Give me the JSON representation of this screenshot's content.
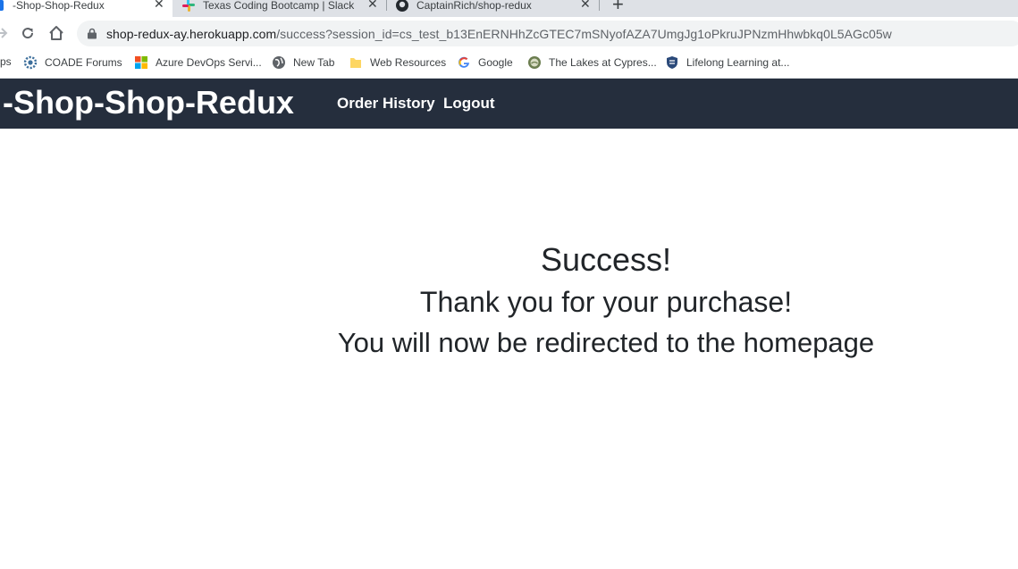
{
  "browser": {
    "tabs": [
      {
        "title": "-Shop-Shop-Redux",
        "favicon": "shop-favicon",
        "active": true
      },
      {
        "title": "Texas Coding Bootcamp | Slack",
        "favicon": "slack-icon",
        "active": false
      },
      {
        "title": "CaptainRich/shop-redux",
        "favicon": "github-icon",
        "active": false
      }
    ],
    "close_glyph": "✕",
    "new_tab_glyph": "+",
    "url_host": "shop-redux-ay.herokuapp.com",
    "url_path": "/success?session_id=cs_test_b13EnERNHhZcGTEC7mSNyofAZA7UmgJg1oPkruJPNzmHhwbkq0L5AGc05w"
  },
  "bookmarks": [
    {
      "label": "ps",
      "icon": "apps-icon"
    },
    {
      "label": "COADE Forums",
      "icon": "gear-icon"
    },
    {
      "label": "Azure DevOps Servi...",
      "icon": "microsoft-icon"
    },
    {
      "label": "New Tab",
      "icon": "globe-icon"
    },
    {
      "label": "Web Resources",
      "icon": "folder-icon"
    },
    {
      "label": "Google",
      "icon": "google-icon"
    },
    {
      "label": "The Lakes at Cypres...",
      "icon": "emblem-icon"
    },
    {
      "label": "Lifelong Learning at...",
      "icon": "shield-icon"
    }
  ],
  "app": {
    "brand": "-Shop-Shop-Redux",
    "nav": {
      "order_history": "Order History",
      "logout": "Logout"
    },
    "header_color": "#252e3d"
  },
  "success": {
    "title": "Success!",
    "thanks": "Thank you for your purchase!",
    "redirect": "You will now be redirected to the homepage"
  }
}
